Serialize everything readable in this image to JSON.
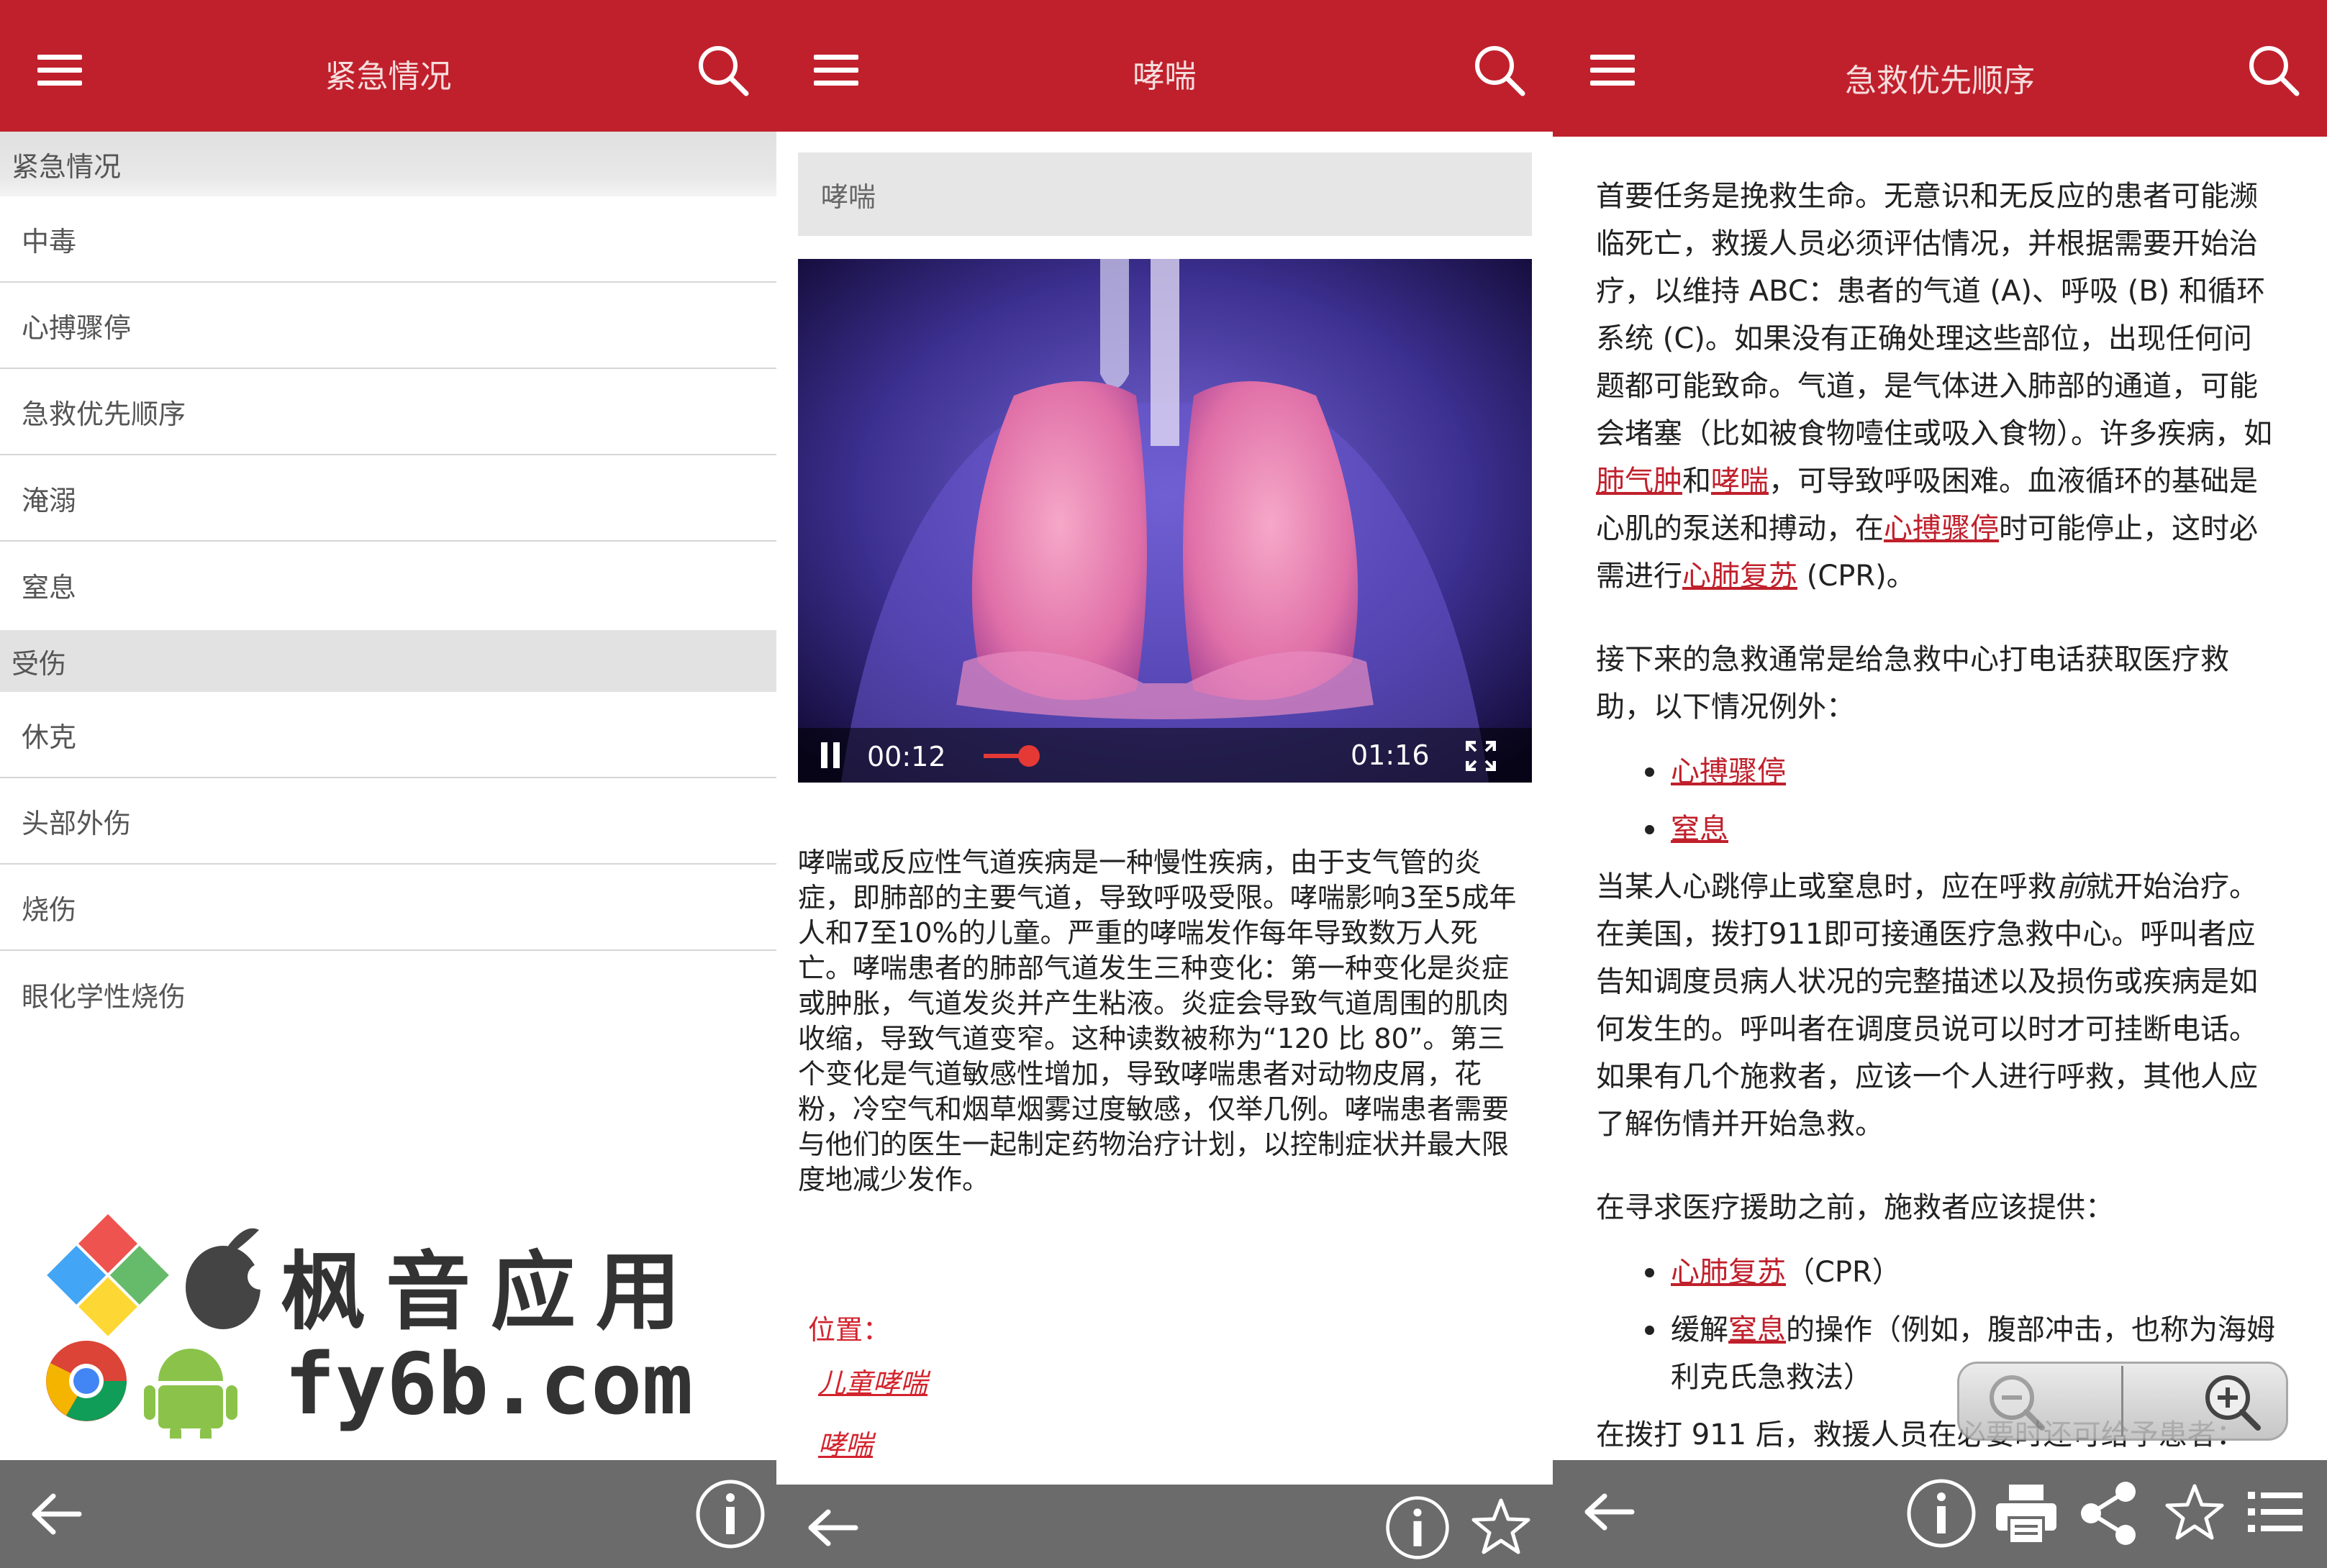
{
  "panel1": {
    "header": {
      "title": "紧急情况"
    },
    "sections": [
      {
        "label": "紧急情况",
        "items": [
          "中毒",
          "心搏骤停",
          "急救优先顺序",
          "淹溺",
          "窒息"
        ]
      },
      {
        "label": "受伤",
        "items": [
          "休克",
          "头部外伤",
          "烧伤",
          "眼化学性烧伤"
        ]
      }
    ]
  },
  "panel2": {
    "header": {
      "title": "哮喘"
    },
    "topic_title": "哮喘",
    "video": {
      "current_time": "00:12",
      "duration": "01:16",
      "progress": 0.16
    },
    "body": "哮喘或反应性气道疾病是一种慢性疾病，由于支气管的炎症，即肺部的主要气道，导致呼吸受限。哮喘影响3至5成年人和7至10%的儿童。严重的哮喘发作每年导致数万人死亡。哮喘患者的肺部气道发生三种变化：第一种变化是炎症或肿胀，气道发炎并产生粘液。炎症会导致气道周围的肌肉收缩，导致气道变窄。这种读数被称为“120 比 80”。第三个变化是气道敏感性增加，导致哮喘患者对动物皮屑，花粉，冷空气和烟草烟雾过度敏感，仅举几例。哮喘患者需要与他们的医生一起制定药物治疗计划，以控制症状并最大限度地减少发作。",
    "location_label": "位置：",
    "location_links": [
      "儿童哮喘",
      "哮喘"
    ]
  },
  "panel3": {
    "header": {
      "title": "急救优先顺序"
    },
    "para1": {
      "t1": "首要任务是挽救生命。无意识和无反应的患者可能濒临死亡，救援人员必须评估情况，并根据需要开始治疗，以维持 ABC：患者的气道 (A)、呼吸 (B) 和循环系统 (C)。如果没有正确处理这些部位，出现任何问题都可能致命。气道，是气体进入肺部的通道，可能会堵塞（比如被食物噎住或吸入食物）。许多疾病，如",
      "l1": "肺气肿",
      "t2": "和",
      "l2": "哮喘",
      "t3": "，可导致呼吸困难。血液循环的基础是心肌的泵送和搏动，在",
      "l3": "心搏骤停",
      "t4": "时可能停止，这时必需进行",
      "l4": "心肺复苏",
      "t5": " (CPR)。"
    },
    "para2": "接下来的急救通常是给急救中心打电话获取医疗救助，以下情况例外：",
    "list1": [
      "心搏骤停",
      "窒息"
    ],
    "para3": {
      "t1": "当某人心跳停止或窒息时，应在呼救",
      "em": "前",
      "t2": "就开始治疗。在美国，拨打911即可接通医疗急救中心。呼叫者应告知调度员病人状况的完整描述以及损伤或疾病是如何发生的。呼叫者在调度员说可以时才可挂断电话。如果有几个施救者，应该一个人进行呼救，其他人应了解伤情并开始急救。"
    },
    "para4": "在寻求医疗援助之前，施救者应该提供：",
    "list2": [
      {
        "link": "心肺复苏",
        "after": "（CPR）"
      },
      {
        "before": "缓解",
        "link": "窒息",
        "after": "的操作（例如，腹部冲击，也称为海姆利克氏急救法）"
      }
    ],
    "cut_line": "在拨打 911 后，救援人员在必要时还可给予患者："
  },
  "watermark": {
    "cn": "枫音应用",
    "url": "fy6b.com"
  },
  "colors": {
    "header_red": "#c0202c",
    "link_red": "#c0202c",
    "footer_gray": "#6b6b6b",
    "section_gray": "#e2e2e2"
  },
  "icons": [
    "menu-icon",
    "search-icon",
    "back-arrow-icon",
    "info-icon",
    "star-icon",
    "print-icon",
    "share-icon",
    "list-icon",
    "zoom-in-icon",
    "zoom-out-icon",
    "pause-icon",
    "fullscreen-icon"
  ]
}
